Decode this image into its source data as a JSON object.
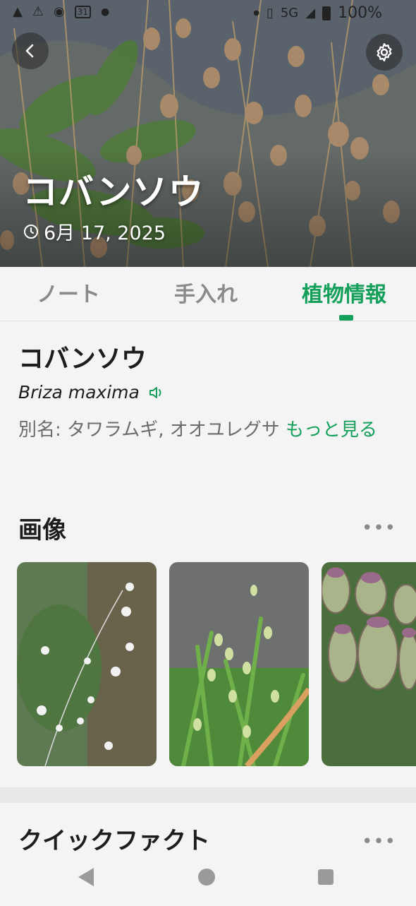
{
  "status_bar": {
    "battery": "100%",
    "network": "5G",
    "calendar_day": "31"
  },
  "header": {
    "title": "コバンソウ",
    "date": "6月 17, 2025",
    "back_icon": "chevron-left-icon",
    "settings_icon": "gear-icon"
  },
  "tabs": [
    {
      "label": "ノート",
      "active": false
    },
    {
      "label": "手入れ",
      "active": false
    },
    {
      "label": "植物情報",
      "active": true
    }
  ],
  "plant": {
    "name": "コバンソウ",
    "scientific_name": "Briza maxima",
    "alias_prefix": "別名: タワラムギ, オオユレグサ ",
    "alias_more": "もっと見る"
  },
  "images_section": {
    "title": "画像",
    "more": "•••"
  },
  "quick_facts": {
    "title": "クイックファクト",
    "more": "•••"
  },
  "colors": {
    "accent": "#14a05a",
    "text": "#1d1d1d",
    "muted": "#8a8a8a"
  }
}
